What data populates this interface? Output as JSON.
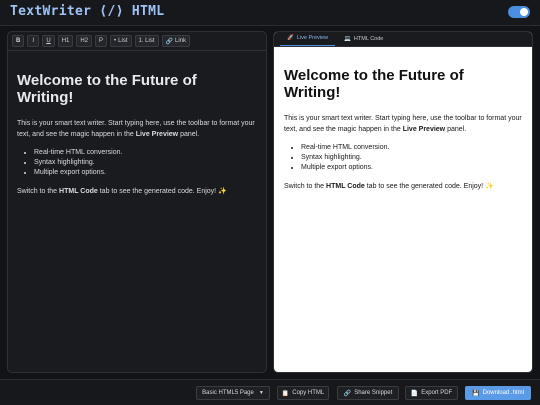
{
  "app": {
    "title": "TextWriter ⟨/⟩ HTML",
    "theme_toggle_on": true,
    "accent_color": "#4a8fe0"
  },
  "toolbar": {
    "buttons": [
      {
        "label": "B"
      },
      {
        "label": "I"
      },
      {
        "label": "U"
      },
      {
        "label": "H1"
      },
      {
        "label": "H2"
      },
      {
        "label": "P"
      },
      {
        "icon": "•",
        "label": "List"
      },
      {
        "label": "1. List"
      },
      {
        "icon": "🔗",
        "label": "Link"
      }
    ]
  },
  "document": {
    "heading": "Welcome to the Future of Writing!",
    "intro_before": "This is your smart text writer. Start typing here, use the toolbar to format your text, and see the magic happen in the ",
    "intro_bold": "Live Preview",
    "intro_after": " panel.",
    "list": [
      "Real-time HTML conversion.",
      "Syntax highlighting.",
      "Multiple export options."
    ],
    "outro_before": "Switch to the ",
    "outro_bold": "HTML Code",
    "outro_after": " tab to see the generated code. Enjoy! ✨"
  },
  "tabs": [
    {
      "icon": "🚀",
      "label": "Live Preview",
      "active": true
    },
    {
      "icon": "💻",
      "label": "HTML Code",
      "active": false
    }
  ],
  "bottom": {
    "template_select": "Basic HTML5 Page",
    "copy": {
      "icon": "📋",
      "label": "Copy HTML"
    },
    "share": {
      "icon": "🔗",
      "label": "Share Snippet"
    },
    "pdf": {
      "icon": "📄",
      "label": "Export PDF"
    },
    "download": {
      "icon": "💾",
      "label": "Download .html"
    }
  }
}
